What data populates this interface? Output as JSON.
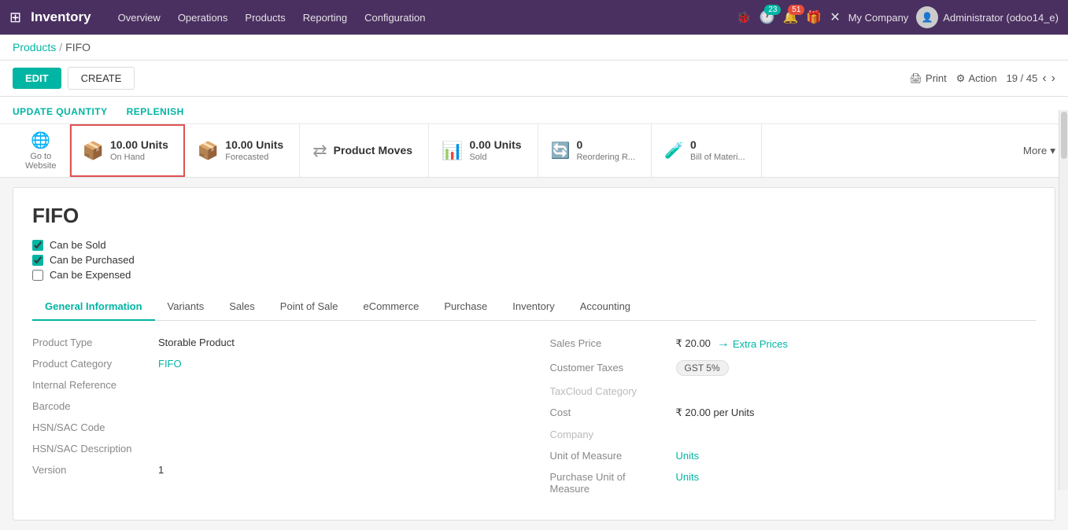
{
  "topnav": {
    "brand": "Inventory",
    "menu_items": [
      "Overview",
      "Operations",
      "Products",
      "Reporting",
      "Configuration"
    ],
    "badge_23": "23",
    "badge_51": "51",
    "company": "My Company",
    "user": "Administrator (odoo14_e)"
  },
  "breadcrumb": {
    "parent": "Products",
    "separator": "/",
    "current": "FIFO"
  },
  "actions": {
    "edit": "EDIT",
    "create": "CREATE",
    "print": "Print",
    "action": "Action",
    "pagination": "19 / 45"
  },
  "smart_links": {
    "update_qty": "UPDATE QUANTITY",
    "replenish": "REPLENISH"
  },
  "stat_buttons": [
    {
      "id": "go-website",
      "icon": "🌐",
      "label1": "Go to",
      "label2": "Website",
      "highlighted": false
    },
    {
      "id": "on-hand",
      "icon": "📦",
      "value": "10.00 Units",
      "label": "On Hand",
      "highlighted": true
    },
    {
      "id": "forecasted",
      "icon": "📦",
      "value": "10.00 Units",
      "label": "Forecasted",
      "highlighted": false
    },
    {
      "id": "product-moves",
      "icon": "⇄",
      "value": "Product Moves",
      "label": "",
      "highlighted": false
    },
    {
      "id": "units-sold",
      "icon": "📊",
      "value": "0.00 Units",
      "label": "Sold",
      "highlighted": false
    },
    {
      "id": "reordering",
      "icon": "🔄",
      "value": "0",
      "label": "Reordering R...",
      "highlighted": false
    },
    {
      "id": "bom",
      "icon": "🧪",
      "value": "0",
      "label": "Bill of Materi...",
      "highlighted": false
    }
  ],
  "more_button": "More",
  "product": {
    "name": "FIFO",
    "can_be_sold": true,
    "can_be_purchased": true,
    "can_be_expensed": false
  },
  "tabs": [
    {
      "id": "general",
      "label": "General Information",
      "active": true
    },
    {
      "id": "variants",
      "label": "Variants",
      "active": false
    },
    {
      "id": "sales",
      "label": "Sales",
      "active": false
    },
    {
      "id": "pos",
      "label": "Point of Sale",
      "active": false
    },
    {
      "id": "ecommerce",
      "label": "eCommerce",
      "active": false
    },
    {
      "id": "purchase",
      "label": "Purchase",
      "active": false
    },
    {
      "id": "inventory",
      "label": "Inventory",
      "active": false
    },
    {
      "id": "accounting",
      "label": "Accounting",
      "active": false
    }
  ],
  "general_info": {
    "left": {
      "product_type_label": "Product Type",
      "product_type_value": "Storable Product",
      "product_category_label": "Product Category",
      "product_category_value": "FIFO",
      "internal_ref_label": "Internal Reference",
      "barcode_label": "Barcode",
      "hsn_sac_label": "HSN/SAC Code",
      "hsn_desc_label": "HSN/SAC Description",
      "version_label": "Version",
      "version_value": "1"
    },
    "right": {
      "sales_price_label": "Sales Price",
      "sales_price_value": "₹ 20.00",
      "extra_prices_label": "Extra Prices",
      "customer_taxes_label": "Customer Taxes",
      "gst_badge": "GST 5%",
      "taxcloud_label": "TaxCloud Category",
      "cost_label": "Cost",
      "cost_value": "₹ 20.00 per Units",
      "company_label": "Company",
      "uom_label": "Unit of Measure",
      "uom_value": "Units",
      "purchase_uom_label": "Purchase Unit of",
      "purchase_uom_value": "Units",
      "measure_label": "Measure"
    }
  }
}
